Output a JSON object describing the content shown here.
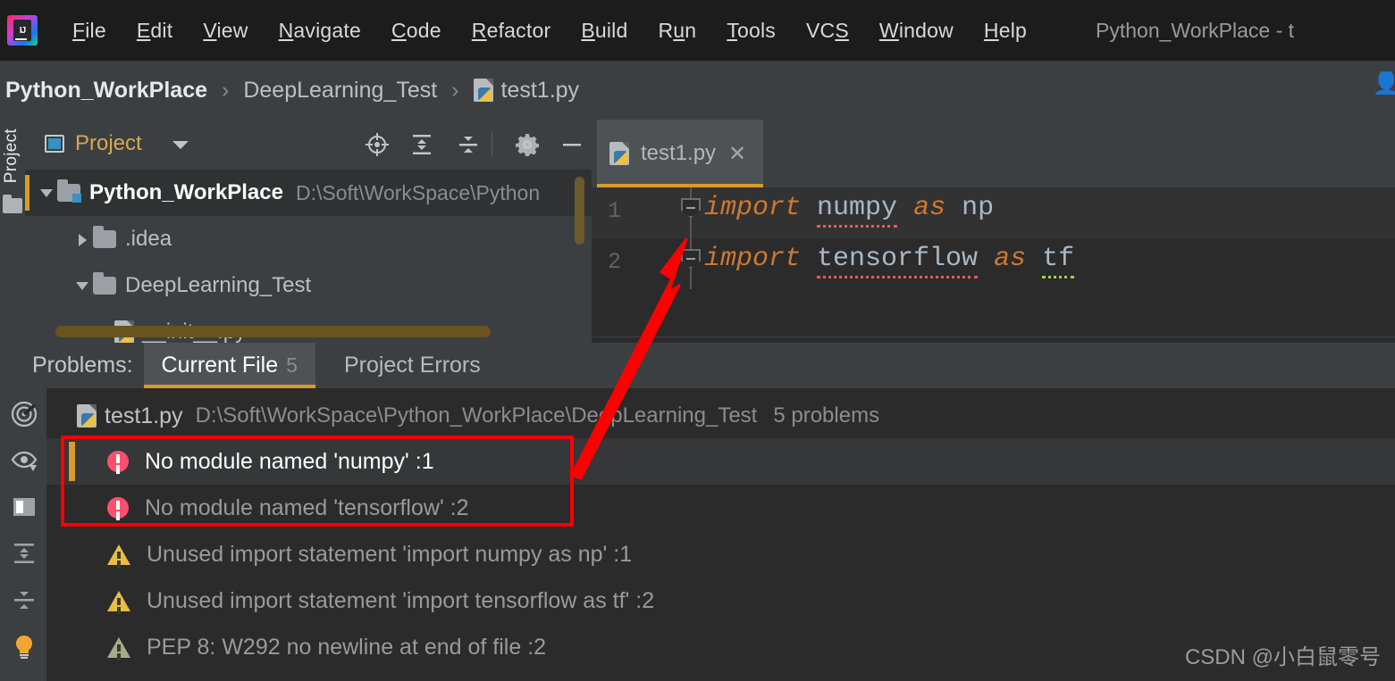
{
  "window": {
    "title": "Python_WorkPlace - t",
    "logo_icon": "intellij-idea-logo"
  },
  "menu": {
    "items": [
      {
        "label": "File",
        "mnemonic": "F"
      },
      {
        "label": "Edit",
        "mnemonic": "E"
      },
      {
        "label": "View",
        "mnemonic": "V"
      },
      {
        "label": "Navigate",
        "mnemonic": "N"
      },
      {
        "label": "Code",
        "mnemonic": "C"
      },
      {
        "label": "Refactor",
        "mnemonic": "R"
      },
      {
        "label": "Build",
        "mnemonic": "B"
      },
      {
        "label": "Run",
        "mnemonic": "u"
      },
      {
        "label": "Tools",
        "mnemonic": "T"
      },
      {
        "label": "VCS",
        "mnemonic": "S"
      },
      {
        "label": "Window",
        "mnemonic": "W"
      },
      {
        "label": "Help",
        "mnemonic": "H"
      }
    ]
  },
  "breadcrumb": {
    "separator": "›",
    "items": [
      {
        "label": "Python_WorkPlace",
        "icon": "none"
      },
      {
        "label": "DeepLearning_Test",
        "icon": "none"
      },
      {
        "label": "test1.py",
        "icon": "python-file-icon"
      }
    ],
    "right_icon": "user-avatar-icon"
  },
  "left_strip": {
    "tab_label": "Project",
    "folder_icon": "folder-icon"
  },
  "project_panel": {
    "title": "Project",
    "title_icon": "project-view-icon",
    "dropdown_icon": "chevron-down-icon",
    "toolbar": [
      {
        "name": "locate-icon",
        "tooltip": "Select Opened File"
      },
      {
        "name": "expand-all-icon",
        "tooltip": "Expand All"
      },
      {
        "name": "collapse-all-icon",
        "tooltip": "Collapse All"
      },
      {
        "name": "gear-icon",
        "tooltip": "Settings"
      },
      {
        "name": "minimize-icon",
        "tooltip": "Hide"
      }
    ],
    "tree": [
      {
        "label": "Python_WorkPlace",
        "path": "D:\\Soft\\WorkSpace\\Python",
        "expanded": true,
        "type": "module",
        "bold": true,
        "indent": 0
      },
      {
        "label": ".idea",
        "path": "",
        "expanded": false,
        "type": "folder",
        "bold": false,
        "indent": 1
      },
      {
        "label": "DeepLearning_Test",
        "path": "",
        "expanded": true,
        "type": "folder",
        "bold": false,
        "indent": 1
      },
      {
        "label": "__init__.py",
        "path": "",
        "expanded": null,
        "type": "python",
        "bold": false,
        "indent": 2
      }
    ]
  },
  "editor": {
    "tab": {
      "label": "test1.py",
      "icon": "python-file-icon",
      "close_icon": "close-icon",
      "active": true
    },
    "lines": [
      {
        "number": "1",
        "segments": [
          {
            "text": "import ",
            "style": "keyword"
          },
          {
            "text": "numpy",
            "style": "error-underline"
          },
          {
            "text": " ",
            "style": "plain"
          },
          {
            "text": "as ",
            "style": "keyword"
          },
          {
            "text": "np",
            "style": "plain"
          }
        ]
      },
      {
        "number": "2",
        "segments": [
          {
            "text": "import ",
            "style": "keyword"
          },
          {
            "text": "tensorflow",
            "style": "error-underline"
          },
          {
            "text": " ",
            "style": "plain"
          },
          {
            "text": "as ",
            "style": "keyword"
          },
          {
            "text": "tf",
            "style": "warn-underline"
          }
        ]
      }
    ]
  },
  "problems_panel": {
    "label": "Problems:",
    "tabs": [
      {
        "label": "Current File",
        "count": "5",
        "active": true
      },
      {
        "label": "Project Errors",
        "count": "",
        "active": false
      }
    ],
    "side_icons": [
      "inspection-radar-icon",
      "eye-preview-icon",
      "layout-panel-icon",
      "expand-all-icon",
      "collapse-all-icon",
      "lightbulb-icon"
    ],
    "file_row": {
      "icon": "python-file-icon",
      "name": "test1.py",
      "path": "D:\\Soft\\WorkSpace\\Python_WorkPlace\\DeepLearning_Test",
      "count": "5 problems"
    },
    "rows": [
      {
        "severity": "error",
        "text": "No module named 'numpy' :1",
        "selected": true
      },
      {
        "severity": "error",
        "text": "No module named 'tensorflow' :2",
        "selected": false
      },
      {
        "severity": "warning",
        "text": "Unused import statement 'import numpy as np' :1",
        "selected": false
      },
      {
        "severity": "warning",
        "text": "Unused import statement 'import tensorflow as tf' :2",
        "selected": false
      },
      {
        "severity": "weak-warning",
        "text": "PEP 8: W292 no newline at end of file :2",
        "selected": false
      }
    ]
  },
  "annotations": {
    "highlight_box_color": "#ff0000",
    "arrow_color": "#ff0000"
  },
  "watermark": {
    "text": "CSDN @小白鼠零号"
  }
}
